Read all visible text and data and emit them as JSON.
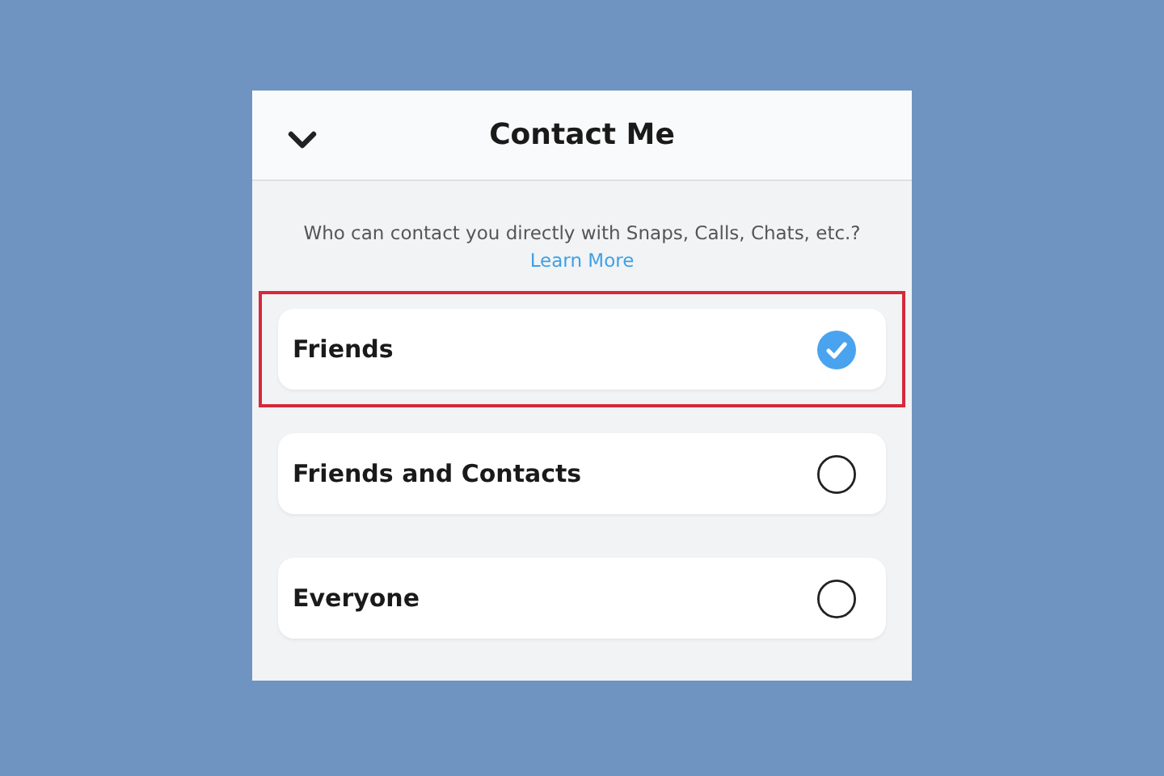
{
  "header": {
    "title": "Contact Me"
  },
  "description": "Who can contact you directly with Snaps, Calls, Chats, etc.?",
  "link": "Learn More",
  "options": [
    {
      "label": "Friends",
      "selected": true,
      "highlighted": true
    },
    {
      "label": "Friends and Contacts",
      "selected": false,
      "highlighted": false
    },
    {
      "label": "Everyone",
      "selected": false,
      "highlighted": false
    }
  ]
}
